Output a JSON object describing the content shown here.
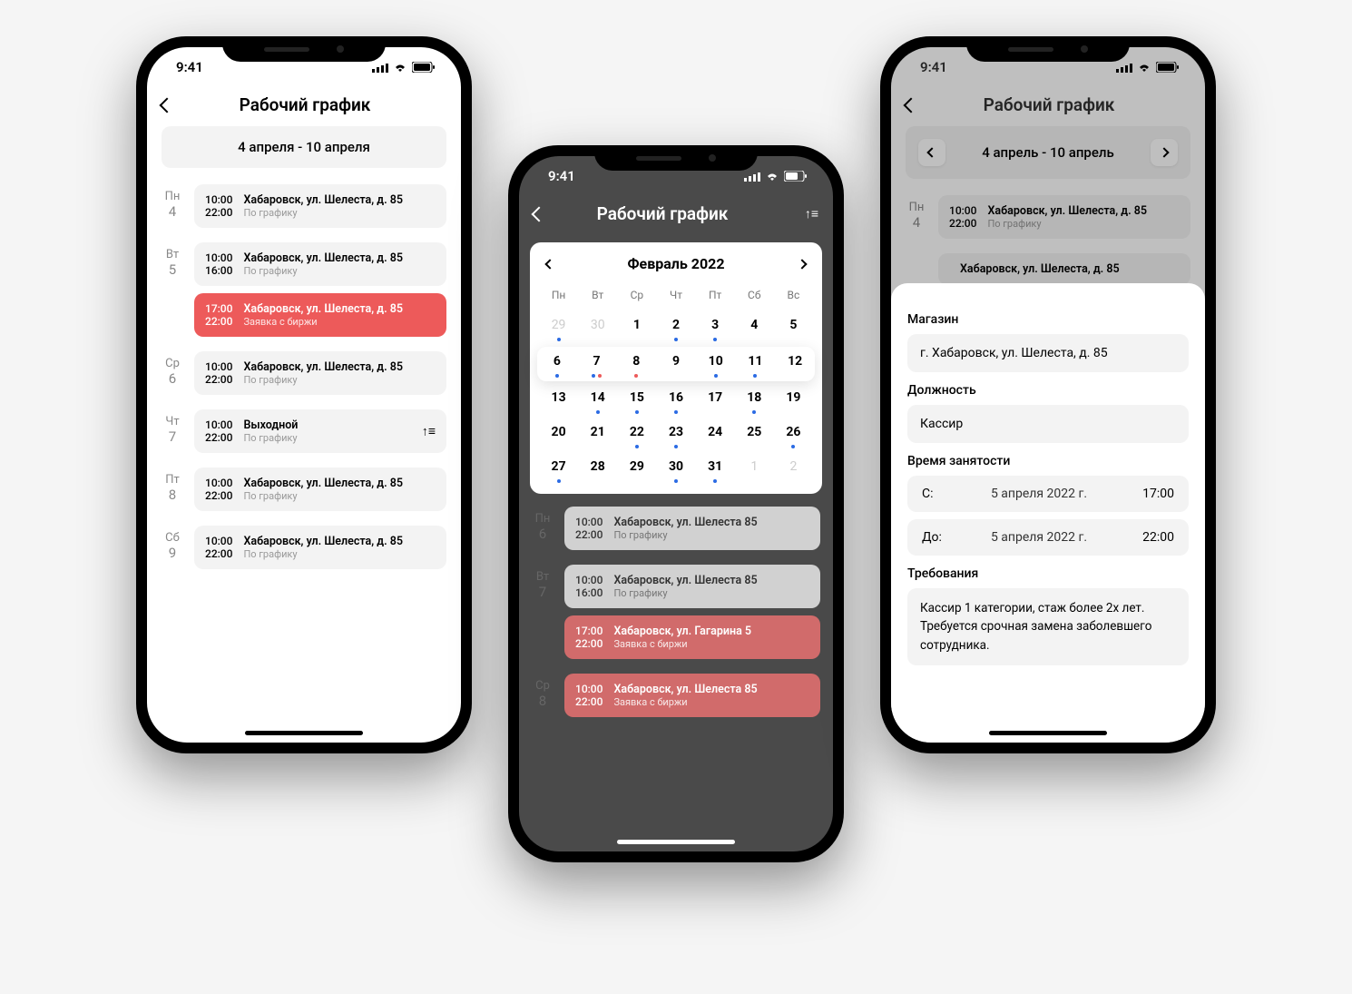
{
  "status_time": "9:41",
  "p1": {
    "title": "Рабочий график",
    "date_range": "4 апреля - 10 апреля",
    "days": [
      {
        "dow": "Пн",
        "num": "4",
        "shifts": [
          {
            "t1": "10:00",
            "t2": "22:00",
            "addr": "Хабаровск, ул. Шелеста, д. 85",
            "sub": "По графику"
          }
        ]
      },
      {
        "dow": "Вт",
        "num": "5",
        "shifts": [
          {
            "t1": "10:00",
            "t2": "16:00",
            "addr": "Хабаровск, ул. Шелеста, д. 85",
            "sub": "По графику"
          },
          {
            "t1": "17:00",
            "t2": "22:00",
            "addr": "Хабаровск, ул. Шелеста, д. 85",
            "sub": "Заявка с биржи",
            "red": true
          }
        ]
      },
      {
        "dow": "Ср",
        "num": "6",
        "shifts": [
          {
            "t1": "10:00",
            "t2": "22:00",
            "addr": "Хабаровск, ул. Шелеста, д. 85",
            "sub": "По графику"
          }
        ]
      },
      {
        "dow": "Чт",
        "num": "7",
        "shifts": [
          {
            "t1": "10:00",
            "t2": "22:00",
            "addr": "Выходной",
            "sub": "По графику",
            "sort": true
          }
        ]
      },
      {
        "dow": "Пт",
        "num": "8",
        "shifts": [
          {
            "t1": "10:00",
            "t2": "22:00",
            "addr": "Хабаровск, ул. Шелеста, д. 85",
            "sub": "По графику"
          }
        ]
      },
      {
        "dow": "Сб",
        "num": "9",
        "shifts": [
          {
            "t1": "10:00",
            "t2": "22:00",
            "addr": "Хабаровск, ул. Шелеста, д. 85",
            "sub": "По графику"
          }
        ]
      }
    ]
  },
  "p2": {
    "title": "Рабочий график",
    "cal_title": "Февраль 2022",
    "dows": [
      "Пн",
      "Вт",
      "Ср",
      "Чт",
      "Пт",
      "Сб",
      "Вс"
    ],
    "weeks": [
      [
        {
          "d": "29",
          "dim": true,
          "dots": [
            "blue"
          ]
        },
        {
          "d": "30",
          "dim": true
        },
        {
          "d": "1",
          "bold": true
        },
        {
          "d": "2",
          "bold": true,
          "dots": [
            "blue"
          ]
        },
        {
          "d": "3",
          "bold": true,
          "dots": [
            "blue"
          ]
        },
        {
          "d": "4",
          "bold": true
        },
        {
          "d": "5",
          "bold": true
        }
      ],
      [
        {
          "d": "6",
          "bold": true,
          "dots": [
            "blue"
          ]
        },
        {
          "d": "7",
          "bold": true,
          "dots": [
            "blue",
            "red"
          ]
        },
        {
          "d": "8",
          "bold": true,
          "dots": [
            "red"
          ]
        },
        {
          "d": "9",
          "bold": true
        },
        {
          "d": "10",
          "bold": true,
          "dots": [
            "blue"
          ]
        },
        {
          "d": "11",
          "bold": true,
          "dots": [
            "blue"
          ]
        },
        {
          "d": "12",
          "bold": true
        }
      ],
      [
        {
          "d": "13",
          "bold": true
        },
        {
          "d": "14",
          "bold": true,
          "dots": [
            "blue"
          ]
        },
        {
          "d": "15",
          "bold": true,
          "dots": [
            "blue"
          ]
        },
        {
          "d": "16",
          "bold": true,
          "dots": [
            "blue"
          ]
        },
        {
          "d": "17",
          "bold": true
        },
        {
          "d": "18",
          "bold": true,
          "dots": [
            "blue"
          ]
        },
        {
          "d": "19",
          "bold": true
        }
      ],
      [
        {
          "d": "20",
          "bold": true
        },
        {
          "d": "21",
          "bold": true
        },
        {
          "d": "22",
          "bold": true,
          "dots": [
            "blue"
          ]
        },
        {
          "d": "23",
          "bold": true,
          "dots": [
            "blue"
          ]
        },
        {
          "d": "24",
          "bold": true
        },
        {
          "d": "25",
          "bold": true
        },
        {
          "d": "26",
          "bold": true,
          "dots": [
            "blue"
          ]
        }
      ],
      [
        {
          "d": "27",
          "bold": true,
          "dots": [
            "blue"
          ]
        },
        {
          "d": "28",
          "bold": true
        },
        {
          "d": "29",
          "bold": true
        },
        {
          "d": "30",
          "bold": true,
          "dots": [
            "blue"
          ]
        },
        {
          "d": "31",
          "bold": true,
          "dots": [
            "blue"
          ]
        },
        {
          "d": "1",
          "dim": true
        },
        {
          "d": "2",
          "dim": true
        }
      ]
    ],
    "list": [
      {
        "dow": "Пн",
        "num": "6",
        "shifts": [
          {
            "t1": "10:00",
            "t2": "22:00",
            "addr": "Хабаровск, ул. Шелеста  85",
            "sub": "По графику"
          }
        ]
      },
      {
        "dow": "Вт",
        "num": "7",
        "shifts": [
          {
            "t1": "10:00",
            "t2": "16:00",
            "addr": "Хабаровск, ул. Шелеста  85",
            "sub": "По графику"
          },
          {
            "t1": "17:00",
            "t2": "22:00",
            "addr": "Хабаровск, ул. Гагарина  5",
            "sub": "Заявка с биржи",
            "red": true
          }
        ]
      },
      {
        "dow": "Ср",
        "num": "8",
        "shifts": [
          {
            "t1": "10:00",
            "t2": "22:00",
            "addr": "Хабаровск, ул. Шелеста  85",
            "sub": "Заявка с биржи",
            "red": true
          }
        ]
      }
    ]
  },
  "p3": {
    "title": "Рабочий график",
    "date_range": "4 апрель - 10 апрель",
    "bg_days": [
      {
        "dow": "Пн",
        "num": "4",
        "shifts": [
          {
            "t1": "10:00",
            "t2": "22:00",
            "addr": "Хабаровск, ул. Шелеста, д. 85",
            "sub": "По графику"
          }
        ]
      },
      {
        "dow": "",
        "num": "",
        "shifts": [
          {
            "t1": "",
            "t2": "",
            "addr": "Хабаровск, ул. Шелеста, д. 85",
            "sub": ""
          }
        ]
      }
    ],
    "sheet": {
      "store_label": "Магазин",
      "store_value": "г. Хабаровск, ул. Шелеста, д. 85",
      "role_label": "Должность",
      "role_value": "Кассир",
      "time_label": "Время занятости",
      "from_label": "С:",
      "to_label": "До:",
      "from_date": "5 апреля 2022 г.",
      "from_time": "17:00",
      "to_date": "5 апреля 2022 г.",
      "to_time": "22:00",
      "req_label": "Требования",
      "req_text": "Кассир 1 категории, стаж более 2х лет. Требуется срочная замена заболевшего сотрудника."
    }
  }
}
